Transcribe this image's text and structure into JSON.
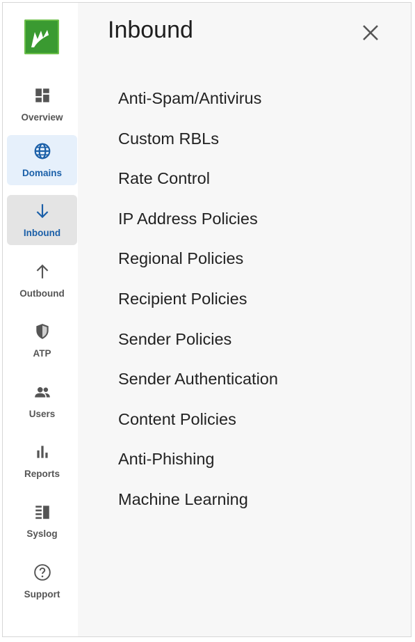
{
  "colors": {
    "brand_green": "#3a9a31",
    "active_blue": "#1a5fa8",
    "domains_bg": "#e6f0fb",
    "inbound_bg": "#e4e4e4",
    "panel_bg": "#f7f7f7"
  },
  "logo": {
    "icon": "barracuda-logo-icon"
  },
  "nav": {
    "items": [
      {
        "label": "Overview",
        "icon": "dashboard-icon"
      },
      {
        "label": "Domains",
        "icon": "globe-icon"
      },
      {
        "label": "Inbound",
        "icon": "arrow-down-icon"
      },
      {
        "label": "Outbound",
        "icon": "arrow-up-icon"
      },
      {
        "label": "ATP",
        "icon": "shield-icon"
      },
      {
        "label": "Users",
        "icon": "users-icon"
      },
      {
        "label": "Reports",
        "icon": "bar-chart-icon"
      },
      {
        "label": "Syslog",
        "icon": "syslog-icon"
      },
      {
        "label": "Support",
        "icon": "help-circle-icon"
      }
    ]
  },
  "panel": {
    "title": "Inbound",
    "close_icon": "close-icon",
    "items": [
      "Anti-Spam/Antivirus",
      "Custom RBLs",
      "Rate Control",
      "IP Address Policies",
      "Regional Policies",
      "Recipient Policies",
      "Sender Policies",
      "Sender Authentication",
      "Content Policies",
      "Anti-Phishing",
      "Machine Learning"
    ]
  }
}
